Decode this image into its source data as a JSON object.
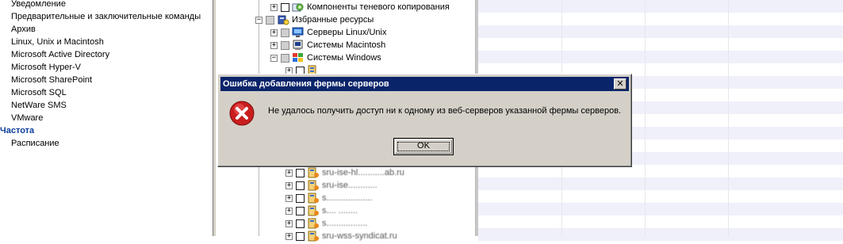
{
  "left_nav": {
    "items": [
      "Уведомление",
      "Предварительные и заключительные команды",
      "Архив",
      "Linux, Unix и Macintosh",
      "Microsoft Active Directory",
      "Microsoft Hyper-V",
      "Microsoft SharePoint",
      "Microsoft SQL",
      "NetWare SMS",
      "VMware"
    ],
    "section": "Частота",
    "sub_items": [
      "Расписание"
    ]
  },
  "tree": {
    "rows": [
      {
        "label": "Компоненты теневого копирования",
        "icon": "shadow-copy-icon"
      },
      {
        "label": "Избранные ресурсы",
        "icon": "favorites-icon"
      },
      {
        "label": "Серверы Linux/Unix",
        "icon": "linux-server-icon"
      },
      {
        "label": "Системы Macintosh",
        "icon": "mac-system-icon"
      },
      {
        "label": "Системы Windows",
        "icon": "windows-system-icon"
      }
    ],
    "obscured_rows": [
      "sru-ise-hl...........ab.ru",
      "sru-ise............",
      "s...................",
      "s.... ........",
      "s.................",
      "sru-wss-syndicat.ru"
    ]
  },
  "dialog": {
    "title": "Ошибка добавления фермы серверов",
    "message": "Не удалось получить доступ ни к одному из веб-серверов указанной фермы серверов.",
    "ok_label": "OK",
    "close_glyph": "✕"
  },
  "colors": {
    "titlebar": "#0a246a",
    "section_link": "#0b3d9a",
    "dialog_face": "#d4d0c8",
    "grid_stripe": "#f0f0fa"
  }
}
